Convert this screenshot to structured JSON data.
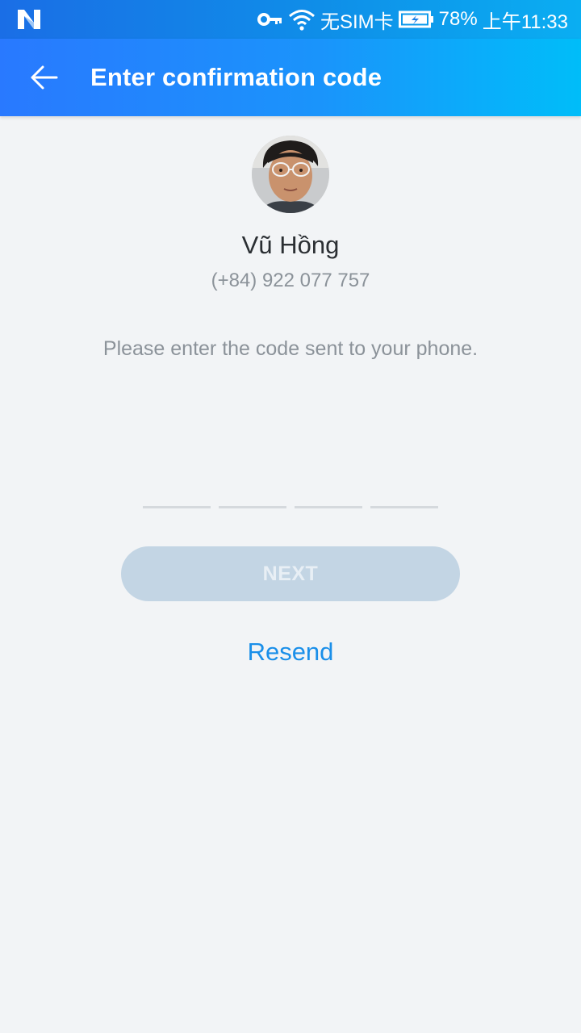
{
  "status_bar": {
    "carrier_text": "无SIM卡",
    "battery": "78%",
    "time": "上午11:33",
    "icons": [
      "notification-n-icon",
      "key-icon",
      "wifi-icon",
      "battery-icon"
    ]
  },
  "header": {
    "title": "Enter confirmation code",
    "back_icon": "arrow-left-icon"
  },
  "profile": {
    "name": "Vũ Hồng",
    "phone": "(+84) 922 077 757"
  },
  "main": {
    "instruction": "Please enter the code sent to your phone.",
    "code_slots": [
      "",
      "",
      "",
      ""
    ],
    "next_label": "NEXT",
    "resend_label": "Resend"
  },
  "colors": {
    "app_bar_start": "#2979ff",
    "app_bar_end": "#00bdf9",
    "link": "#1a8fe9",
    "button_disabled": "#c3d5e4"
  }
}
